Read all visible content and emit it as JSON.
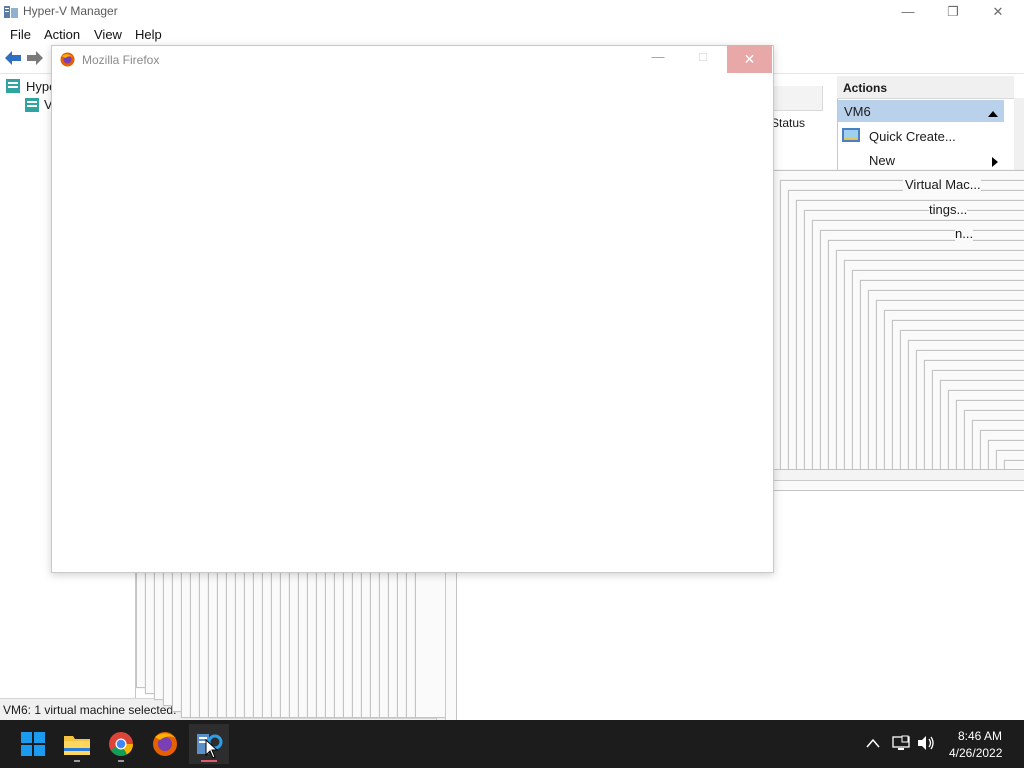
{
  "hyperv": {
    "title": "Hyper-V Manager",
    "menu": [
      "File",
      "Action",
      "View",
      "Help"
    ],
    "tree": {
      "root_label": "Hype",
      "child_label": "V"
    },
    "column_header": "Status",
    "actions": {
      "title": "Actions",
      "section": "VM6",
      "items": [
        "Quick Create...",
        "New",
        "Virtual Mac...",
        "tings...",
        "n..."
      ]
    },
    "status_text": "VM6:  1 virtual machine selected."
  },
  "firefox": {
    "title": "Mozilla Firefox"
  },
  "taskbar": {
    "time": "8:46 AM",
    "date": "4/26/2022"
  },
  "colors": {
    "accent_selection": "#b9d1ea",
    "taskbar": "#1c1c1c",
    "close_hover": "#e8a8a8"
  },
  "icons": [
    "hyperv-app-icon",
    "back-arrow-icon",
    "forward-arrow-icon",
    "server-icon",
    "quick-create-icon",
    "submenu-arrow-icon",
    "collapse-arrow-icon",
    "firefox-icon",
    "windows-start-icon",
    "file-explorer-icon",
    "chrome-icon",
    "hyperv-taskbar-icon",
    "chevron-up-icon",
    "network-icon",
    "volume-icon"
  ]
}
